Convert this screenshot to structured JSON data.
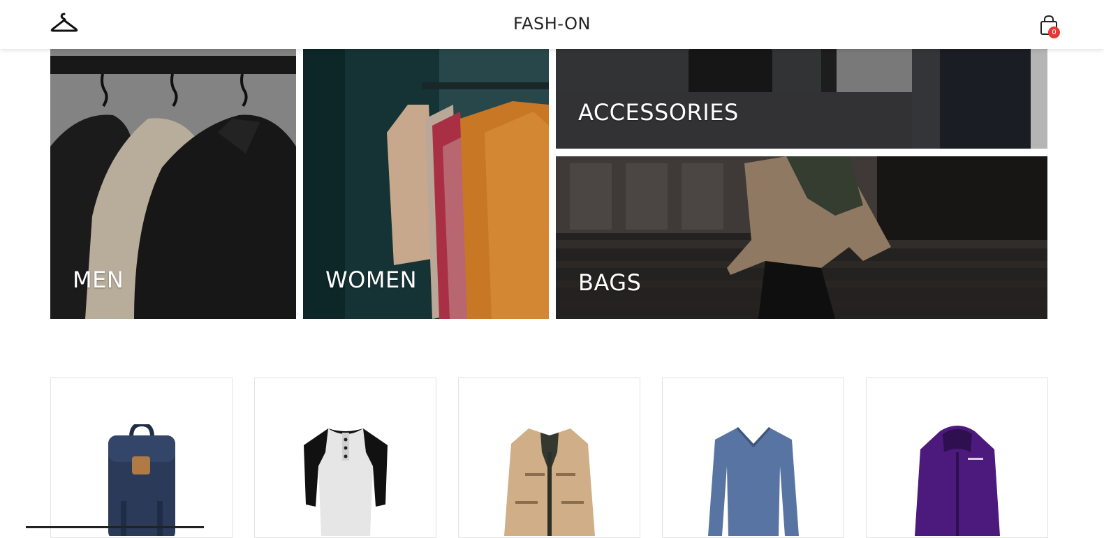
{
  "header": {
    "brand": "FASH-ON",
    "logo_icon": "hanger-icon",
    "cart_icon": "shopping-bag-icon",
    "cart_count": "0"
  },
  "categories": [
    {
      "label": "MEN"
    },
    {
      "label": "WOMEN"
    },
    {
      "label": "ACCESSORIES"
    },
    {
      "label": "BAGS"
    }
  ],
  "products": [
    {
      "icon": "backpack-icon",
      "color": "#2a3a58"
    },
    {
      "icon": "raglan-henley-shirt-icon",
      "color": "#e6e6e6"
    },
    {
      "icon": "khaki-jacket-icon",
      "color": "#cfae88"
    },
    {
      "icon": "blue-vneck-sweater-icon",
      "color": "#5874a2"
    },
    {
      "icon": "purple-parka-icon",
      "color": "#4b1a7c"
    }
  ],
  "colors": {
    "badge": "#e53935",
    "card_border": "#e3e3e3"
  }
}
